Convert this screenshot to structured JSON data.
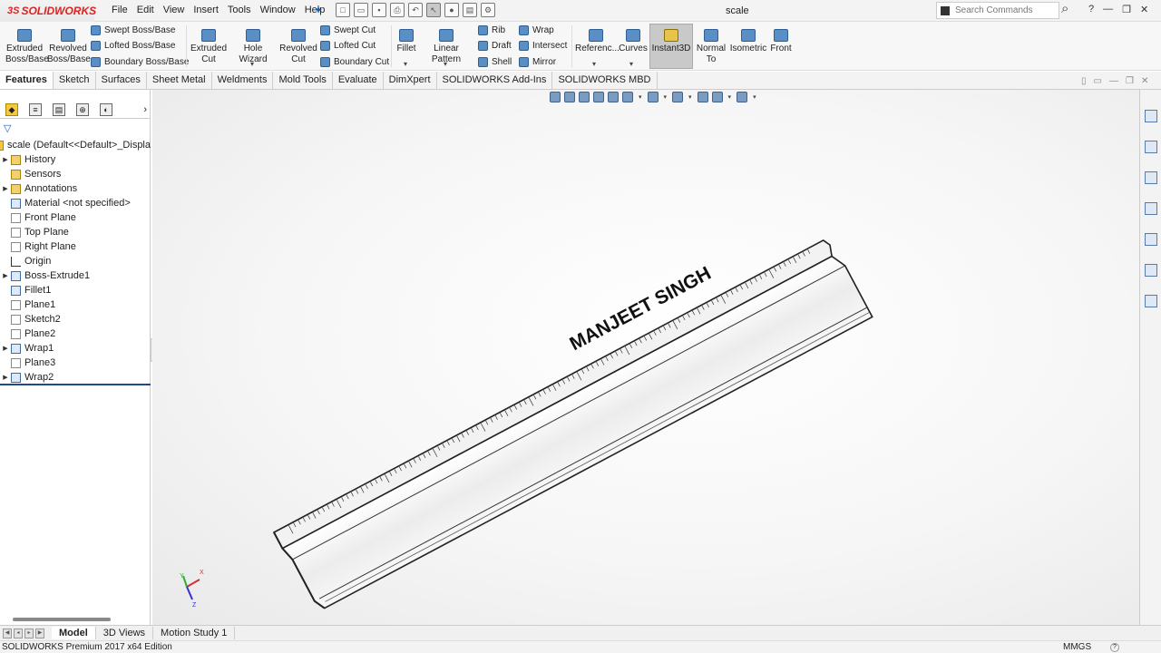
{
  "app": {
    "brand": "SOLIDWORKS",
    "document_title": "scale"
  },
  "menu": [
    "File",
    "Edit",
    "View",
    "Insert",
    "Tools",
    "Window",
    "Help"
  ],
  "search": {
    "placeholder": "Search Commands"
  },
  "ribbon": {
    "extruded_boss": "Extruded Boss/Base",
    "revolved_boss": "Revolved Boss/Base",
    "swept_boss": "Swept Boss/Base",
    "lofted_boss": "Lofted Boss/Base",
    "boundary_boss": "Boundary Boss/Base",
    "extruded_cut": "Extruded Cut",
    "hole_wizard": "Hole Wizard",
    "revolved_cut": "Revolved Cut",
    "swept_cut": "Swept Cut",
    "lofted_cut": "Lofted Cut",
    "boundary_cut": "Boundary Cut",
    "fillet": "Fillet",
    "linear_pattern": "Linear Pattern",
    "rib": "Rib",
    "draft": "Draft",
    "shell": "Shell",
    "wrap": "Wrap",
    "intersect": "Intersect",
    "mirror": "Mirror",
    "reference": "Referenc...",
    "curves": "Curves",
    "instant3d": "Instant3D",
    "normal_to": "Normal To",
    "isometric": "Isometric",
    "front": "Front"
  },
  "tabs": [
    "Features",
    "Sketch",
    "Surfaces",
    "Sheet Metal",
    "Weldments",
    "Mold Tools",
    "Evaluate",
    "DimXpert",
    "SOLIDWORKS Add-Ins",
    "SOLIDWORKS MBD"
  ],
  "tree": [
    {
      "label": "scale  (Default<<Default>_Displa",
      "icon": "part-icon",
      "expand": false
    },
    {
      "label": "History",
      "icon": "history-icon",
      "expand": true
    },
    {
      "label": "Sensors",
      "icon": "sensors-icon",
      "expand": false
    },
    {
      "label": "Annotations",
      "icon": "annotations-icon",
      "expand": true
    },
    {
      "label": "Material <not specified>",
      "icon": "material-icon",
      "expand": false
    },
    {
      "label": "Front Plane",
      "icon": "plane-icon",
      "expand": false
    },
    {
      "label": "Top Plane",
      "icon": "plane-icon",
      "expand": false
    },
    {
      "label": "Right Plane",
      "icon": "plane-icon",
      "expand": false
    },
    {
      "label": "Origin",
      "icon": "origin-icon",
      "expand": false
    },
    {
      "label": "Boss-Extrude1",
      "icon": "extrude-icon",
      "expand": true
    },
    {
      "label": "Fillet1",
      "icon": "fillet-icon",
      "expand": false
    },
    {
      "label": "Plane1",
      "icon": "plane-icon",
      "expand": false
    },
    {
      "label": "Sketch2",
      "icon": "sketch-icon",
      "expand": false
    },
    {
      "label": "Plane2",
      "icon": "plane-icon",
      "expand": false
    },
    {
      "label": "Wrap1",
      "icon": "wrap-icon",
      "expand": true
    },
    {
      "label": "Plane3",
      "icon": "plane-icon",
      "expand": false
    },
    {
      "label": "Wrap2",
      "icon": "wrap-icon",
      "expand": true
    }
  ],
  "model": {
    "engraved_text": "MANJEET SINGH"
  },
  "triad": {
    "x": "X",
    "y": "Y",
    "z": "Z"
  },
  "bottom_tabs": [
    "Model",
    "3D Views",
    "Motion Study 1"
  ],
  "status": {
    "edition": "SOLIDWORKS Premium 2017 x64 Edition",
    "units": "MMGS",
    "help": "?"
  }
}
